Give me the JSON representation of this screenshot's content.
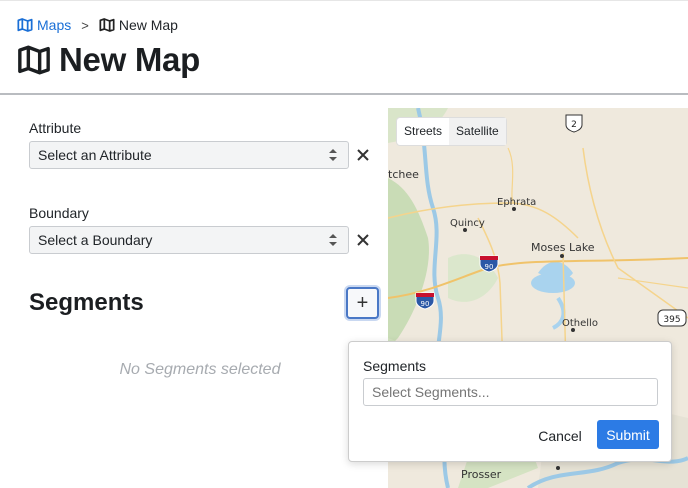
{
  "breadcrumb": {
    "root_label": "Maps",
    "root_icon": "map-icon",
    "current_label": "New Map",
    "current_icon": "map-icon",
    "separator": ">"
  },
  "page": {
    "title": "New Map",
    "title_icon": "map-icon"
  },
  "form": {
    "attribute": {
      "label": "Attribute",
      "placeholder": "Select an Attribute",
      "clear_icon": "close-icon"
    },
    "boundary": {
      "label": "Boundary",
      "placeholder": "Select a Boundary",
      "clear_icon": "close-icon"
    },
    "segments": {
      "title": "Segments",
      "add_label": "+",
      "empty_message": "No Segments selected"
    }
  },
  "map": {
    "toggle": {
      "options": [
        "Streets",
        "Satellite"
      ],
      "selected": "Satellite"
    },
    "labels": [
      "tchee",
      "Ephrata",
      "Quincy",
      "Moses Lake",
      "Othello",
      "Prosser"
    ],
    "shields": [
      "2",
      "90",
      "90",
      "395"
    ]
  },
  "popover": {
    "label": "Segments",
    "placeholder": "Select Segments...",
    "cancel_label": "Cancel",
    "submit_label": "Submit"
  },
  "colors": {
    "accent": "#2c7be5",
    "link": "#1a6fd6",
    "muted": "#a7abb0"
  }
}
